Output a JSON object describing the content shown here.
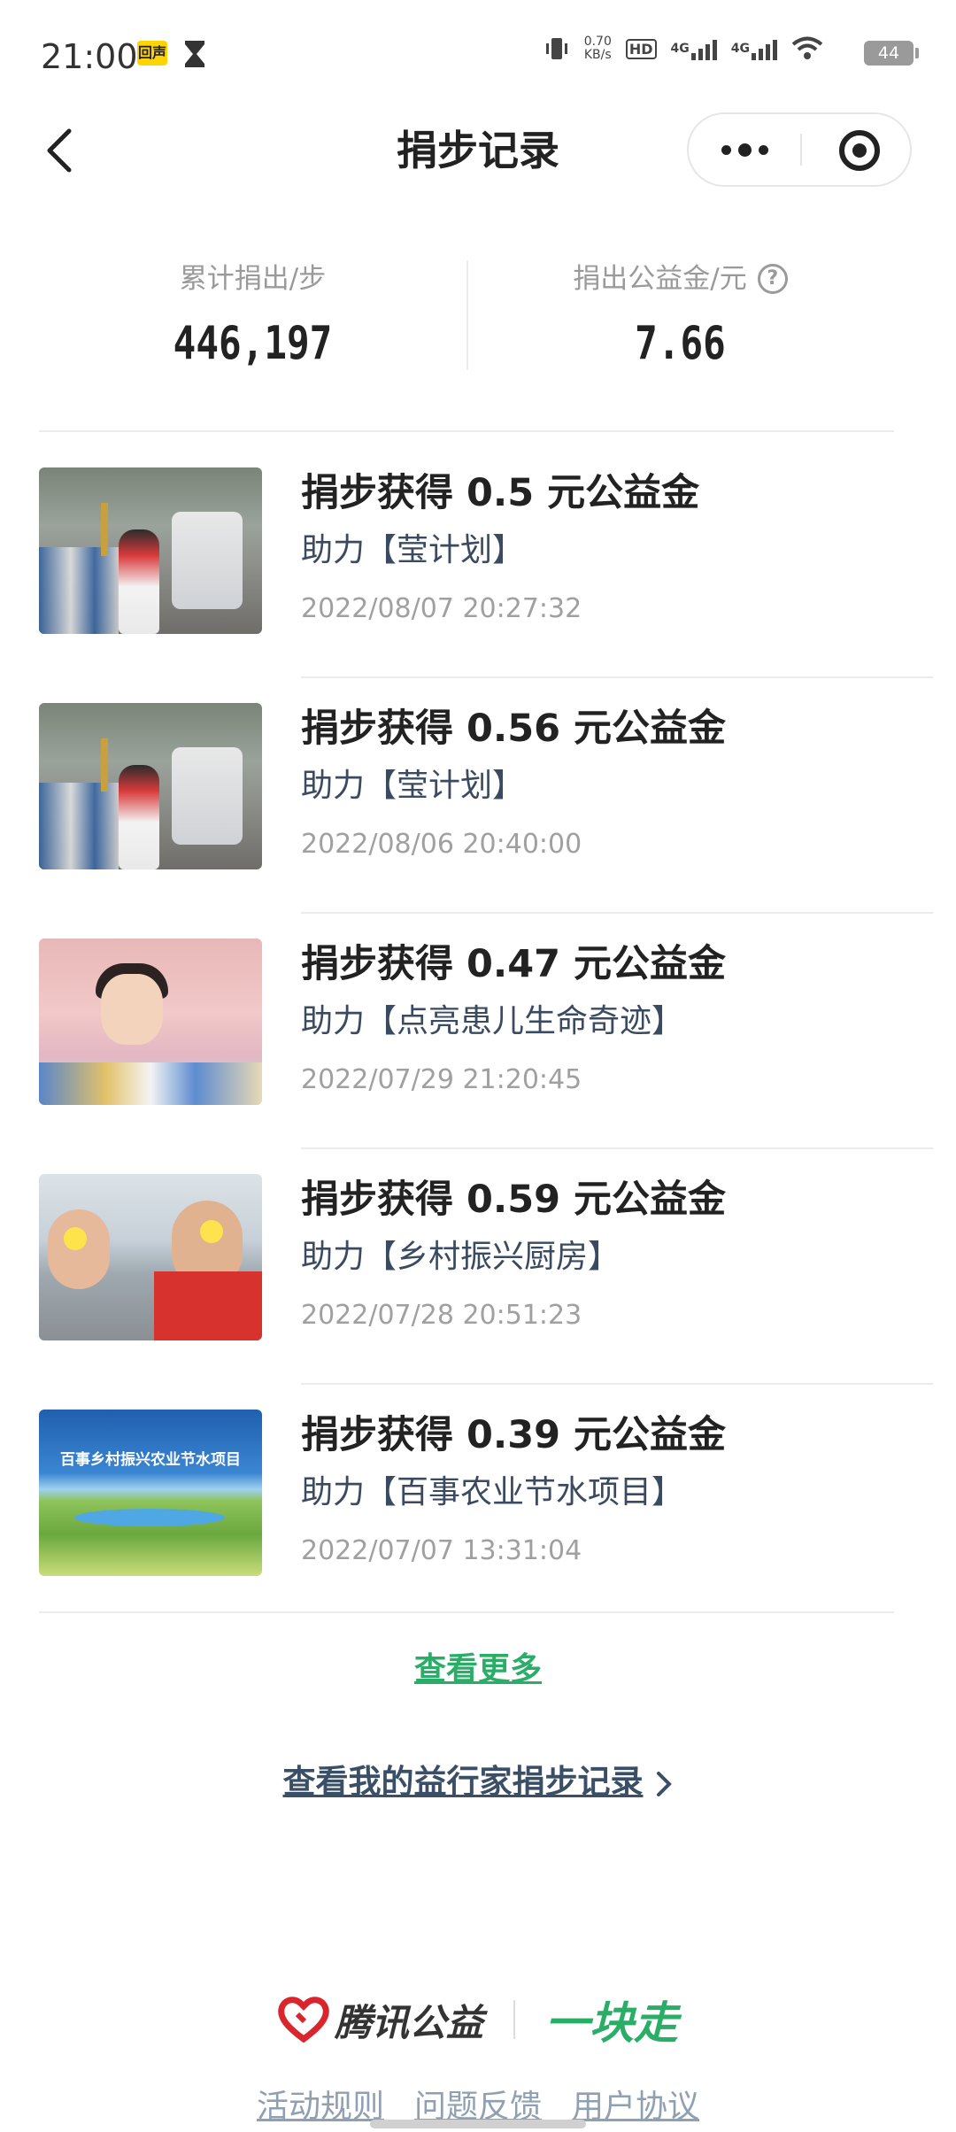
{
  "status_bar": {
    "time": "21:00",
    "badge": "回声",
    "net_speed": "0.70",
    "net_unit": "KB/s",
    "hd": "HD",
    "net1": "4G",
    "net2": "4G",
    "battery": "44"
  },
  "nav": {
    "title": "捐步记录"
  },
  "summary": {
    "steps_label": "累计捐出/步",
    "steps_value": "446,197",
    "money_label": "捐出公益金/元",
    "money_value": "7.66"
  },
  "records": [
    {
      "title": "捐步获得 0.5 元公益金",
      "project": "助力【莹计划】",
      "time": "2022/08/07 20:27:32"
    },
    {
      "title": "捐步获得 0.56 元公益金",
      "project": "助力【莹计划】",
      "time": "2022/08/06 20:40:00"
    },
    {
      "title": "捐步获得 0.47 元公益金",
      "project": "助力【点亮患儿生命奇迹】",
      "time": "2022/07/29 21:20:45"
    },
    {
      "title": "捐步获得 0.59 元公益金",
      "project": "助力【乡村振兴厨房】",
      "time": "2022/07/28 20:51:23"
    },
    {
      "title": "捐步获得 0.39 元公益金",
      "project": "助力【百事农业节水项目】",
      "time": "2022/07/07 13:31:04",
      "thumb_text": "百事乡村振兴农业节水项目"
    }
  ],
  "links": {
    "view_more": "查看更多",
    "walker_record": "查看我的益行家捐步记录"
  },
  "footer": {
    "brand": "腾讯公益",
    "campaign": "一块走",
    "rules": "活动规则",
    "feedback": "问题反馈",
    "agreement": "用户协议"
  },
  "colors": {
    "accent_green": "#2aae67",
    "link_blue": "#3a4e66",
    "muted": "#a0a0a0"
  }
}
